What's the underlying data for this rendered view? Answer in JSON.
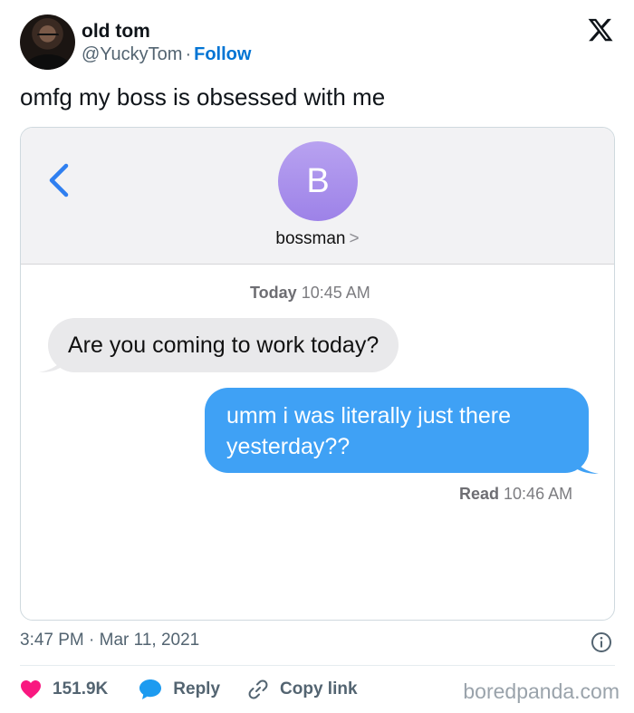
{
  "author": {
    "name": "old tom",
    "handle": "@YuckyTom",
    "separator": "·",
    "follow_label": "Follow"
  },
  "brand_icon": "x-logo-icon",
  "tweet_text": "omfg my boss is obsessed with me",
  "conversation": {
    "contact_initial": "B",
    "contact_name": "bossman",
    "contact_chevron": ">",
    "timestamp_day": "Today",
    "timestamp_time": "10:45 AM",
    "incoming_message": "Are you coming to work today?",
    "outgoing_message_line1": "umm i was literally just there",
    "outgoing_message_line2": "yesterday??",
    "read_label": "Read",
    "read_time": "10:46 AM"
  },
  "meta": {
    "time": "3:47 PM",
    "separator": "·",
    "date": "Mar 11, 2021"
  },
  "actions": {
    "like_count": "151.9K",
    "reply_label": "Reply",
    "copy_link_label": "Copy link"
  },
  "watermark": "boredpanda.com",
  "colors": {
    "link_blue": "#0074d4",
    "bubble_blue": "#3fa1f5",
    "bubble_gray": "#e9e9eb",
    "like_red": "#f91880",
    "reply_blue": "#1d9bf0",
    "contact_avatar": "#a48aea"
  }
}
